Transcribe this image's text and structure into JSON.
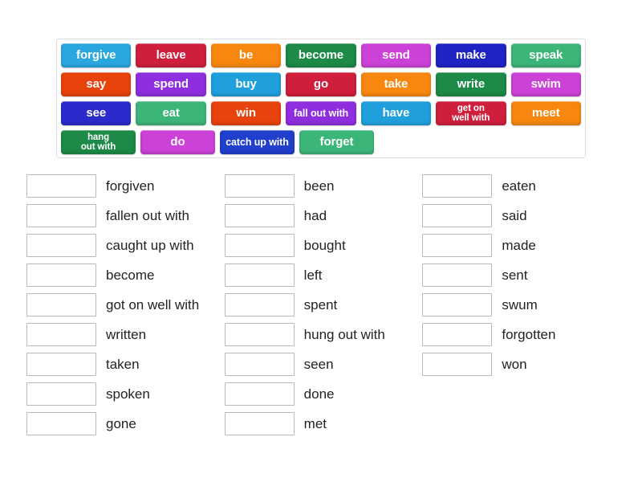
{
  "activity": {
    "type": "match-up-drag-and-drop",
    "word_bank": {
      "rows": [
        [
          {
            "label": "forgive",
            "color": "#2ba7e0",
            "lines": 1
          },
          {
            "label": "leave",
            "color": "#cf1f3d",
            "lines": 1
          },
          {
            "label": "be",
            "color": "#f7870f",
            "lines": 1
          },
          {
            "label": "become",
            "color": "#1d8a47",
            "lines": 1
          },
          {
            "label": "send",
            "color": "#cc41d8",
            "lines": 1
          },
          {
            "label": "make",
            "color": "#1f23c4",
            "lines": 1
          },
          {
            "label": "speak",
            "color": "#3cb579",
            "lines": 1
          }
        ],
        [
          {
            "label": "say",
            "color": "#e8420d",
            "lines": 1
          },
          {
            "label": "spend",
            "color": "#8e2ede",
            "lines": 1
          },
          {
            "label": "buy",
            "color": "#1f9fdc",
            "lines": 1
          },
          {
            "label": "go",
            "color": "#cf1f3d",
            "lines": 1
          },
          {
            "label": "take",
            "color": "#f7870f",
            "lines": 1
          },
          {
            "label": "write",
            "color": "#1d8a47",
            "lines": 1
          },
          {
            "label": "swim",
            "color": "#cc41d8",
            "lines": 1
          }
        ],
        [
          {
            "label": "see",
            "color": "#2b2bcc",
            "lines": 1
          },
          {
            "label": "eat",
            "color": "#3cb579",
            "lines": 1
          },
          {
            "label": "win",
            "color": "#e8420d",
            "lines": 1
          },
          {
            "label": "fall out with",
            "color": "#8e2ede",
            "lines": 1,
            "size": "small"
          },
          {
            "label": "have",
            "color": "#1f9fdc",
            "lines": 1
          },
          {
            "label": "get on\nwell with",
            "color": "#cf1f3d",
            "lines": 2
          },
          {
            "label": "meet",
            "color": "#f7870f",
            "lines": 1
          }
        ],
        [
          {
            "label": "hang\nout with",
            "color": "#1d8a47",
            "lines": 2
          },
          {
            "label": "do",
            "color": "#cc41d8",
            "lines": 1
          },
          {
            "label": "catch up with",
            "color": "#1f3fcc",
            "lines": 1,
            "size": "small"
          },
          {
            "label": "forget",
            "color": "#3cb579",
            "lines": 1
          }
        ]
      ]
    },
    "answers": {
      "columns": [
        {
          "items": [
            {
              "answer": "forgiven",
              "box_value": ""
            },
            {
              "answer": "fallen out with",
              "box_value": ""
            },
            {
              "answer": "caught up with",
              "box_value": ""
            },
            {
              "answer": "become",
              "box_value": ""
            },
            {
              "answer": "got on well with",
              "box_value": ""
            },
            {
              "answer": "written",
              "box_value": ""
            },
            {
              "answer": "taken",
              "box_value": ""
            },
            {
              "answer": "spoken",
              "box_value": ""
            },
            {
              "answer": "gone",
              "box_value": ""
            }
          ]
        },
        {
          "items": [
            {
              "answer": "been",
              "box_value": ""
            },
            {
              "answer": "had",
              "box_value": ""
            },
            {
              "answer": "bought",
              "box_value": ""
            },
            {
              "answer": "left",
              "box_value": ""
            },
            {
              "answer": "spent",
              "box_value": ""
            },
            {
              "answer": "hung out with",
              "box_value": ""
            },
            {
              "answer": "seen",
              "box_value": ""
            },
            {
              "answer": "done",
              "box_value": ""
            },
            {
              "answer": "met",
              "box_value": ""
            }
          ]
        },
        {
          "items": [
            {
              "answer": "eaten",
              "box_value": ""
            },
            {
              "answer": "said",
              "box_value": ""
            },
            {
              "answer": "made",
              "box_value": ""
            },
            {
              "answer": "sent",
              "box_value": ""
            },
            {
              "answer": "swum",
              "box_value": ""
            },
            {
              "answer": "forgotten",
              "box_value": ""
            },
            {
              "answer": "won",
              "box_value": ""
            }
          ]
        }
      ]
    },
    "colors": {
      "panel_border": "#dddddd",
      "box_border": "#b9b9b9",
      "text": "#222222",
      "background": "#ffffff"
    }
  }
}
